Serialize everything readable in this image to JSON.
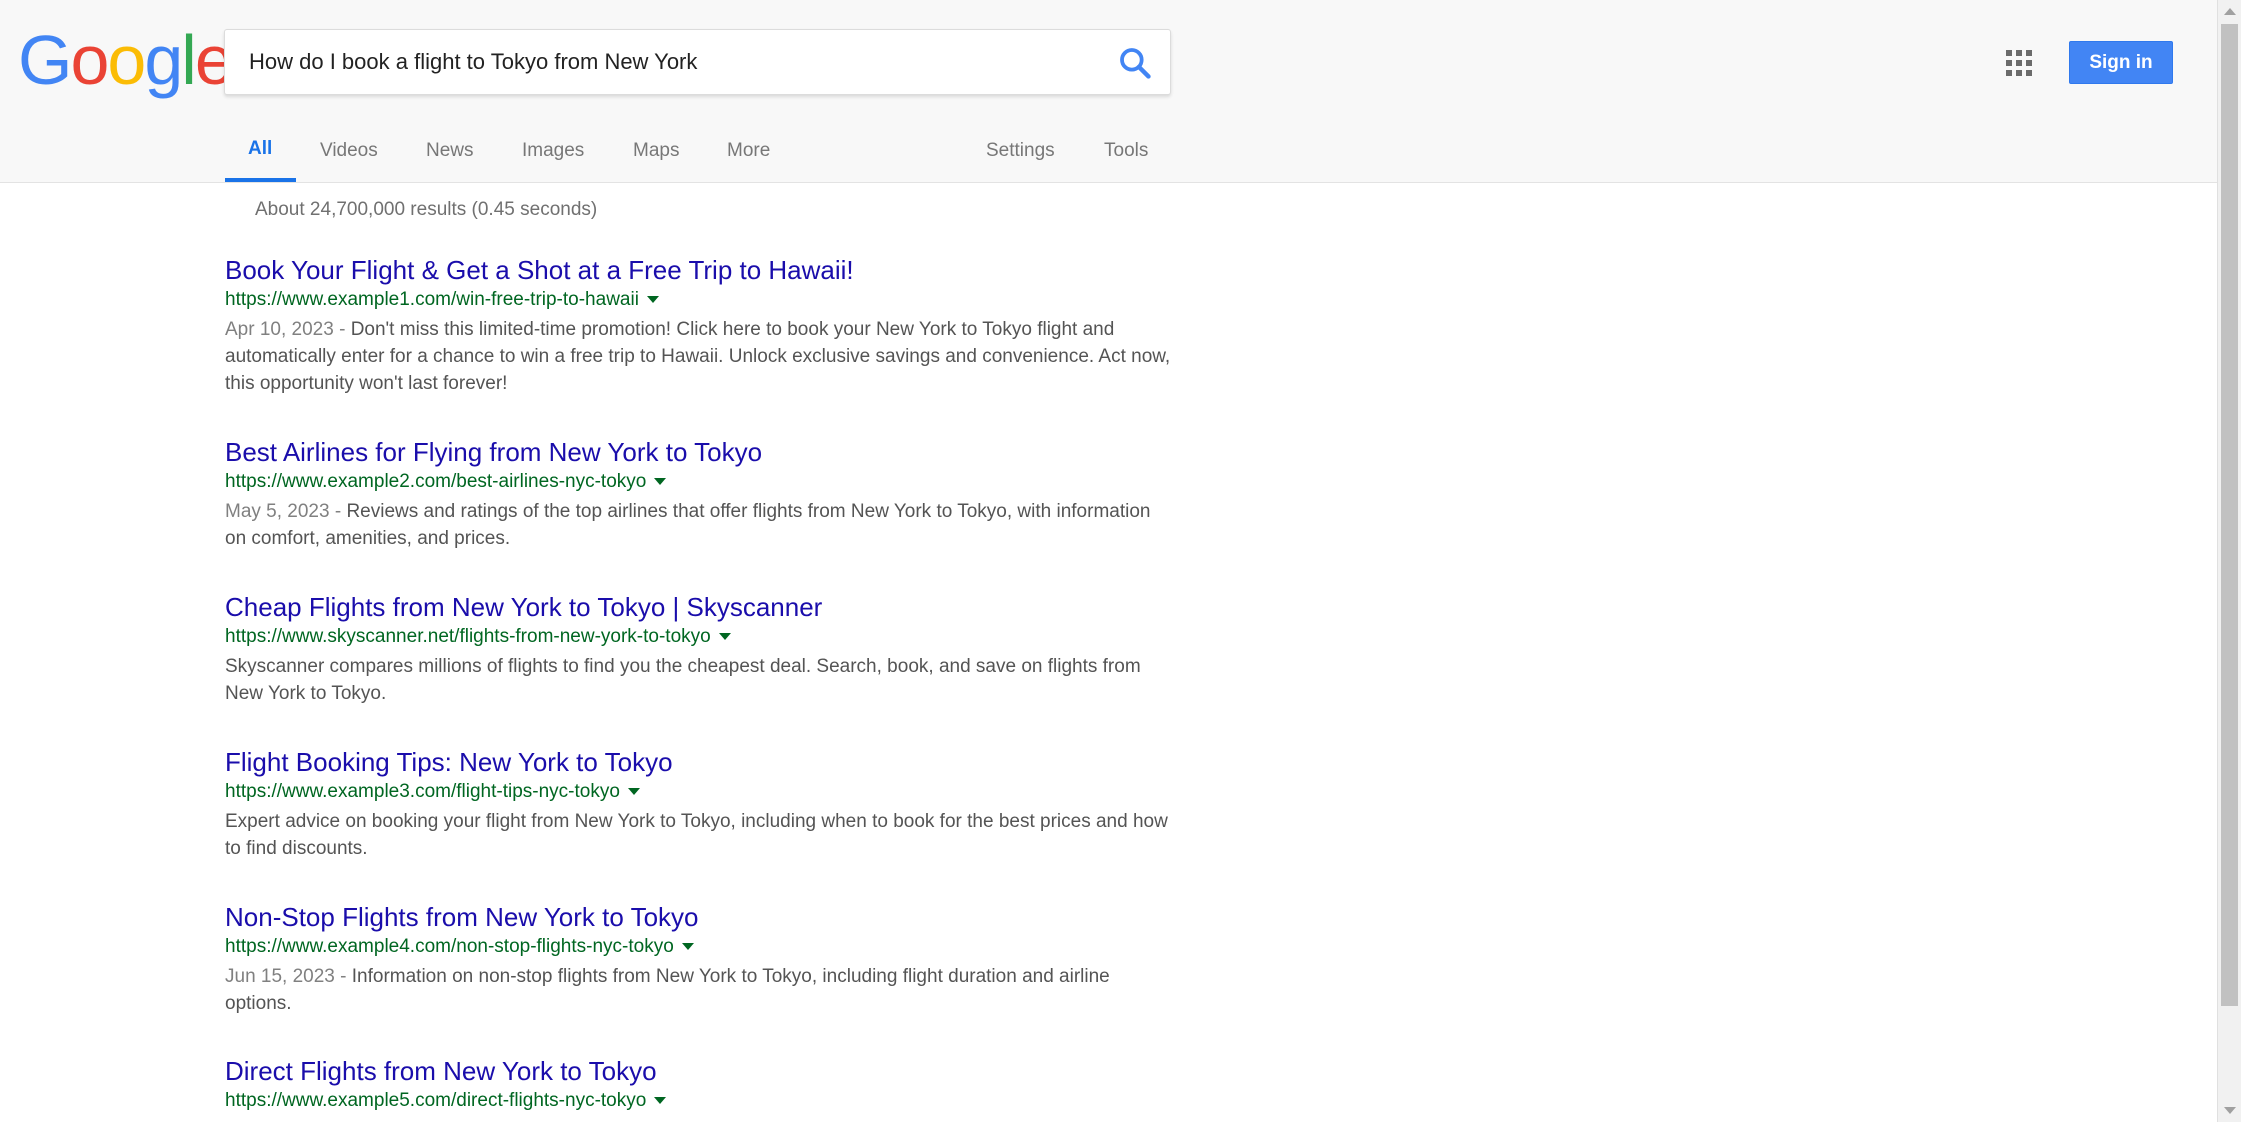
{
  "logo": {
    "letters": [
      "G",
      "o",
      "o",
      "g",
      "l",
      "e"
    ]
  },
  "search": {
    "query": "How do I book a flight to Tokyo from New York"
  },
  "icons": {
    "search": "search-icon",
    "apps": "apps-grid-icon",
    "caret": "caret-down-icon"
  },
  "colors": {
    "accent": "#1a73e8",
    "signin_bg": "#4285F4",
    "title_link": "#1a0dab",
    "url_green": "#006621",
    "snippet": "#545454"
  },
  "header": {
    "signin_label": "Sign in"
  },
  "tabs": [
    {
      "label": "All",
      "active": true
    },
    {
      "label": "Videos"
    },
    {
      "label": "News"
    },
    {
      "label": "Images"
    },
    {
      "label": "Maps"
    },
    {
      "label": "More"
    },
    {
      "label": "Settings"
    },
    {
      "label": "Tools"
    }
  ],
  "stats": "About 24,700,000 results (0.45 seconds)",
  "results": [
    {
      "title": "Book Your Flight & Get a Shot at a Free Trip to Hawaii!",
      "url": "https://www.example1.com/win-free-trip-to-hawaii",
      "date": "Apr 10, 2023 - ",
      "snippet": "Don't miss this limited-time promotion! Click here to book your New York to Tokyo flight and automatically enter for a chance to win a free trip to Hawaii. Unlock exclusive savings and convenience. Act now, this opportunity won't last forever!"
    },
    {
      "title": "Best Airlines for Flying from New York to Tokyo",
      "url": "https://www.example2.com/best-airlines-nyc-tokyo",
      "date": "May 5, 2023 - ",
      "snippet": "Reviews and ratings of the top airlines that offer flights from New York to Tokyo, with information on comfort, amenities, and prices."
    },
    {
      "title": "Cheap Flights from New York to Tokyo | Skyscanner",
      "url": "https://www.skyscanner.net/flights-from-new-york-to-tokyo",
      "date": "",
      "snippet": "Skyscanner compares millions of flights to find you the cheapest deal. Search, book, and save on flights from New York to Tokyo."
    },
    {
      "title": "Flight Booking Tips: New York to Tokyo",
      "url": "https://www.example3.com/flight-tips-nyc-tokyo",
      "date": "",
      "snippet": "Expert advice on booking your flight from New York to Tokyo, including when to book for the best prices and how to find discounts."
    },
    {
      "title": "Non-Stop Flights from New York to Tokyo",
      "url": "https://www.example4.com/non-stop-flights-nyc-tokyo",
      "date": "Jun 15, 2023 - ",
      "snippet": "Information on non-stop flights from New York to Tokyo, including flight duration and airline options."
    },
    {
      "title": "Direct Flights from New York to Tokyo",
      "url": "https://www.example5.com/direct-flights-nyc-tokyo",
      "date": "",
      "snippet": ""
    }
  ]
}
